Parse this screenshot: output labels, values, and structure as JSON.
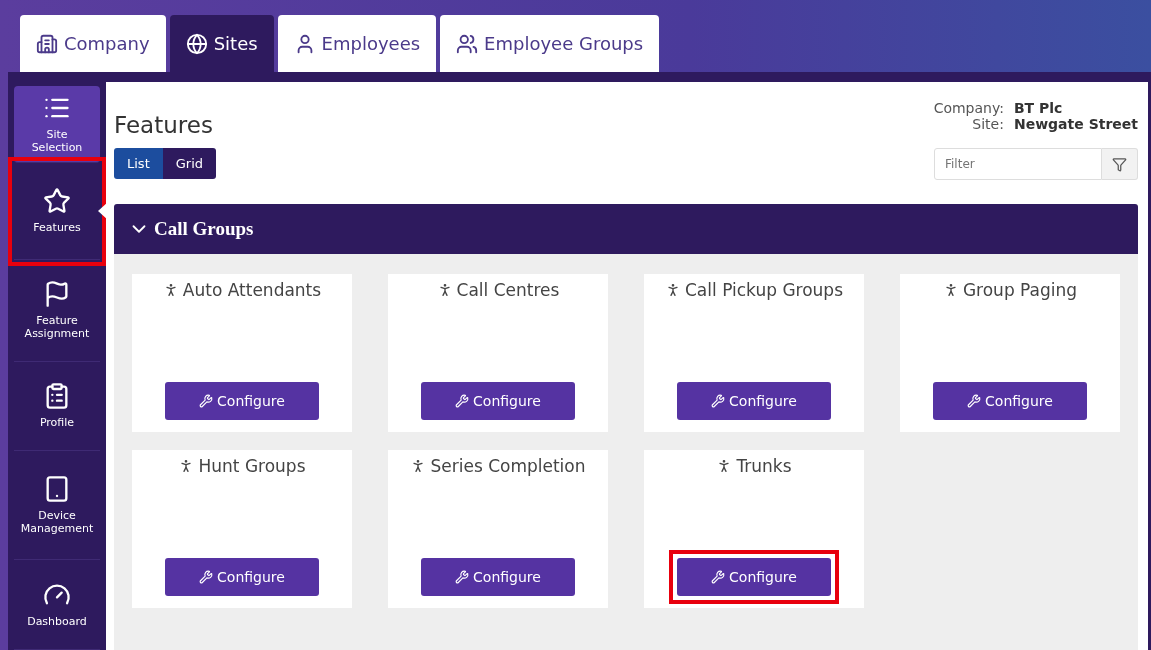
{
  "tabs": [
    {
      "label": "Company",
      "selected": false
    },
    {
      "label": "Sites",
      "selected": true
    },
    {
      "label": "Employees",
      "selected": false
    },
    {
      "label": "Employee Groups",
      "selected": false
    }
  ],
  "sidebar": {
    "items": [
      {
        "label": "Site Selection",
        "selected": false,
        "raised": true,
        "annotated": false
      },
      {
        "label": "Features",
        "selected": true,
        "raised": false,
        "annotated": true
      },
      {
        "label": "Feature Assignment",
        "selected": false,
        "raised": false,
        "annotated": false
      },
      {
        "label": "Profile",
        "selected": false,
        "raised": false,
        "annotated": false
      },
      {
        "label": "Device Management",
        "selected": false,
        "raised": false,
        "annotated": false
      },
      {
        "label": "Dashboard",
        "selected": false,
        "raised": false,
        "annotated": false
      }
    ]
  },
  "page": {
    "title": "Features",
    "views": [
      {
        "label": "List",
        "selected": true
      },
      {
        "label": "Grid",
        "selected": false
      }
    ],
    "context": [
      {
        "label": "Company:",
        "value": "BT Plc"
      },
      {
        "label": "Site:",
        "value": "Newgate Street"
      }
    ],
    "filter": {
      "placeholder": "Filter"
    }
  },
  "section": {
    "title": "Call Groups",
    "expanded": true,
    "cards": [
      {
        "title": "Auto Attendants",
        "button": "Configure",
        "annotated": false
      },
      {
        "title": "Call Centres",
        "button": "Configure",
        "annotated": false
      },
      {
        "title": "Call Pickup Groups",
        "button": "Configure",
        "annotated": false
      },
      {
        "title": "Group Paging",
        "button": "Configure",
        "annotated": false
      },
      {
        "title": "Hunt Groups",
        "button": "Configure",
        "annotated": false
      },
      {
        "title": "Series Completion",
        "button": "Configure",
        "annotated": false
      },
      {
        "title": "Trunks",
        "button": "Configure",
        "annotated": true
      }
    ]
  }
}
